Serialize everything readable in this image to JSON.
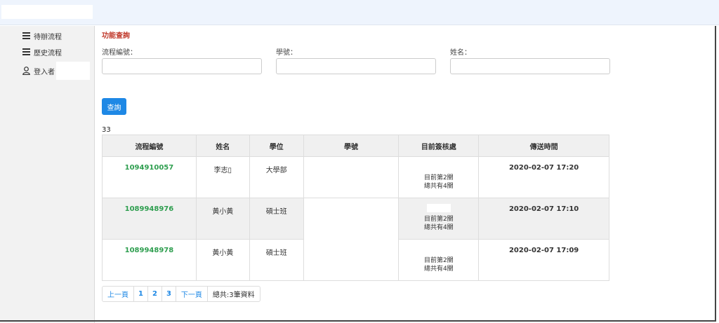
{
  "sidebar": {
    "items": [
      {
        "label": "待辦流程",
        "icon": "menu-icon"
      },
      {
        "label": "歷史流程",
        "icon": "menu-icon"
      },
      {
        "label": "登入者",
        "icon": "user-icon"
      }
    ]
  },
  "search": {
    "title": "功能查詢",
    "fields": [
      {
        "label": "流程編號：",
        "value": ""
      },
      {
        "label": "學號：",
        "value": ""
      },
      {
        "label": "姓名：",
        "value": ""
      }
    ],
    "button_label": "查詢"
  },
  "result_count": "33",
  "table": {
    "headers": [
      "流程編號",
      "姓名",
      "學位",
      "學號",
      "目前簽核處",
      "傳送時間"
    ],
    "rows": [
      {
        "id": "1094910057",
        "name": "李志▯",
        "degree": "大學部",
        "student_no": "",
        "stage": "目前第2關",
        "total": "總共有4關",
        "time": "2020-02-07 17:20"
      },
      {
        "id": "1089948976",
        "name": "黃小黃",
        "degree": "碩士班",
        "student_no": "",
        "stage": "目前第2關",
        "total": "總共有4關",
        "time": "2020-02-07 17:10"
      },
      {
        "id": "1089948978",
        "name": "黃小黃",
        "degree": "碩士班",
        "student_no": "",
        "stage": "目前第2關",
        "total": "總共有4關",
        "time": "2020-02-07 17:09"
      }
    ]
  },
  "pager": {
    "prev": "上一頁",
    "pages": [
      "1",
      "2",
      "3"
    ],
    "next": "下一頁",
    "total": "總共:3筆資料"
  },
  "colors": {
    "accent": "#1e88e5",
    "title": "#c0392b",
    "id_link": "#2e9e4f"
  }
}
